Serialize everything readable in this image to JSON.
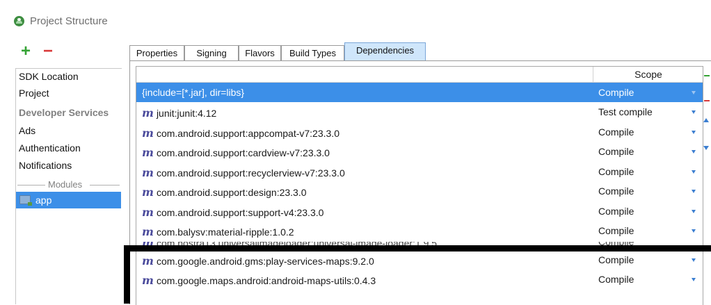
{
  "window": {
    "title": "Project Structure"
  },
  "left_pane": {
    "add_label": "+",
    "remove_label": "−",
    "items": [
      {
        "label": "SDK Location",
        "type": "item"
      },
      {
        "label": "Project",
        "type": "item"
      },
      {
        "label": "Developer Services",
        "type": "header"
      },
      {
        "label": "Ads",
        "type": "item"
      },
      {
        "label": "Authentication",
        "type": "item"
      },
      {
        "label": "Notifications",
        "type": "item"
      }
    ],
    "modules_label": "Modules",
    "module": {
      "label": "app",
      "icon": "module-folder-icon"
    }
  },
  "tabs": [
    {
      "label": "Properties"
    },
    {
      "label": "Signing"
    },
    {
      "label": "Flavors"
    },
    {
      "label": "Build Types"
    },
    {
      "label": "Dependencies",
      "active": true
    }
  ],
  "table": {
    "columns": {
      "name": "",
      "scope": "Scope"
    },
    "rows": [
      {
        "name": "{include=[*.jar], dir=libs}",
        "scope": "Compile",
        "selected": true,
        "icon": ""
      },
      {
        "name": "junit:junit:4.12",
        "scope": "Test compile",
        "icon": "m"
      },
      {
        "name": "com.android.support:appcompat-v7:23.3.0",
        "scope": "Compile",
        "icon": "m"
      },
      {
        "name": "com.android.support:cardview-v7:23.3.0",
        "scope": "Compile",
        "icon": "m"
      },
      {
        "name": "com.android.support:recyclerview-v7:23.3.0",
        "scope": "Compile",
        "icon": "m"
      },
      {
        "name": "com.android.support:design:23.3.0",
        "scope": "Compile",
        "icon": "m"
      },
      {
        "name": "com.android.support:support-v4:23.3.0",
        "scope": "Compile",
        "icon": "m"
      },
      {
        "name": "com.balysv:material-ripple:1.0.2",
        "scope": "Compile",
        "icon": "m"
      },
      {
        "name": "com.nostra13.universalimageloader:universal-image-loader:1.9.5",
        "scope": "Compile",
        "icon": "m",
        "cutoff": true
      },
      {
        "name": "com.google.android.gms:play-services-maps:9.2.0",
        "scope": "Compile",
        "icon": "m"
      },
      {
        "name": "com.google.maps.android:android-maps-utils:0.4.3",
        "scope": "Compile",
        "icon": "m"
      }
    ]
  },
  "colors": {
    "selection": "#3c8fe8",
    "add": "#35a335",
    "remove": "#d93a3a",
    "maven_icon": "#4b4b9c"
  }
}
